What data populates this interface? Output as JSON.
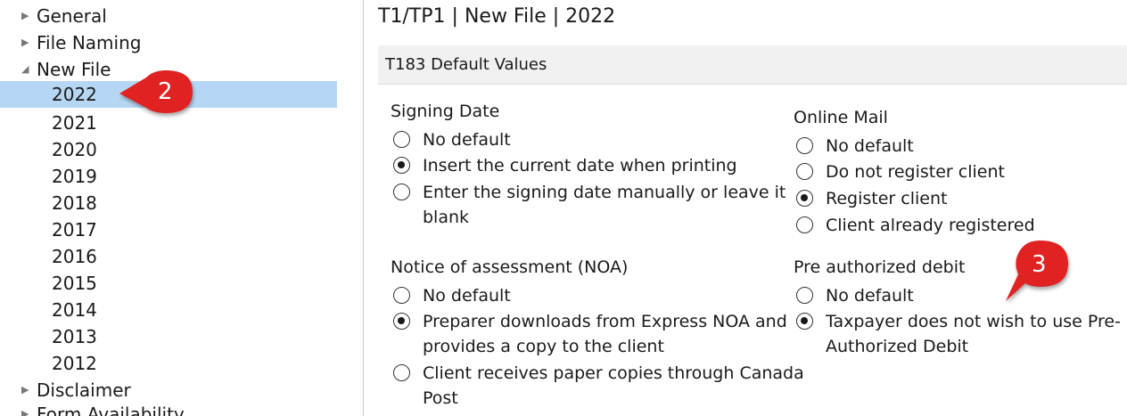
{
  "tree": {
    "items": [
      {
        "label": "General",
        "type": "collapsed"
      },
      {
        "label": "File Naming",
        "type": "collapsed"
      },
      {
        "label": "New File",
        "type": "expanded"
      },
      {
        "label": "2022",
        "type": "child",
        "selected": true
      },
      {
        "label": "2021",
        "type": "child"
      },
      {
        "label": "2020",
        "type": "child"
      },
      {
        "label": "2019",
        "type": "child"
      },
      {
        "label": "2018",
        "type": "child"
      },
      {
        "label": "2017",
        "type": "child"
      },
      {
        "label": "2016",
        "type": "child"
      },
      {
        "label": "2015",
        "type": "child"
      },
      {
        "label": "2014",
        "type": "child"
      },
      {
        "label": "2013",
        "type": "child"
      },
      {
        "label": "2012",
        "type": "child"
      },
      {
        "label": "Disclaimer",
        "type": "collapsed"
      },
      {
        "label": "Form Availability",
        "type": "collapsed"
      }
    ]
  },
  "main": {
    "title": "T1/TP1 | New File | 2022",
    "section_header": "T183 Default Values",
    "signing_date": {
      "title": "Signing Date",
      "options": [
        {
          "label": "No default",
          "checked": false
        },
        {
          "label": "Insert the current date when printing",
          "checked": true
        },
        {
          "label": "Enter the signing date manually or leave it",
          "label2": "blank",
          "checked": false
        }
      ]
    },
    "online_mail": {
      "title": "Online Mail",
      "options": [
        {
          "label": "No default",
          "checked": false
        },
        {
          "label": "Do not register client",
          "checked": false
        },
        {
          "label": "Register client",
          "checked": true
        },
        {
          "label": "Client already registered",
          "checked": false
        }
      ]
    },
    "noa": {
      "title": "Notice of assessment (NOA)",
      "options": [
        {
          "label": "No default",
          "checked": false
        },
        {
          "label": "Preparer downloads from Express NOA and",
          "label2": "provides a copy to the client",
          "checked": true
        },
        {
          "label": "Client receives paper copies through Canada",
          "label2": "Post",
          "checked": false
        }
      ]
    },
    "pad": {
      "title": "Pre authorized debit",
      "options": [
        {
          "label": "No default",
          "checked": false
        },
        {
          "label": "Taxpayer does not wish to use Pre-",
          "label2": "Authorized Debit",
          "checked": true
        }
      ]
    }
  },
  "callouts": {
    "c2": "2",
    "c3": "3",
    "color": "#e02020"
  },
  "colors": {
    "selection": "#b6d7f3",
    "header_bg": "#f1f1f1"
  }
}
